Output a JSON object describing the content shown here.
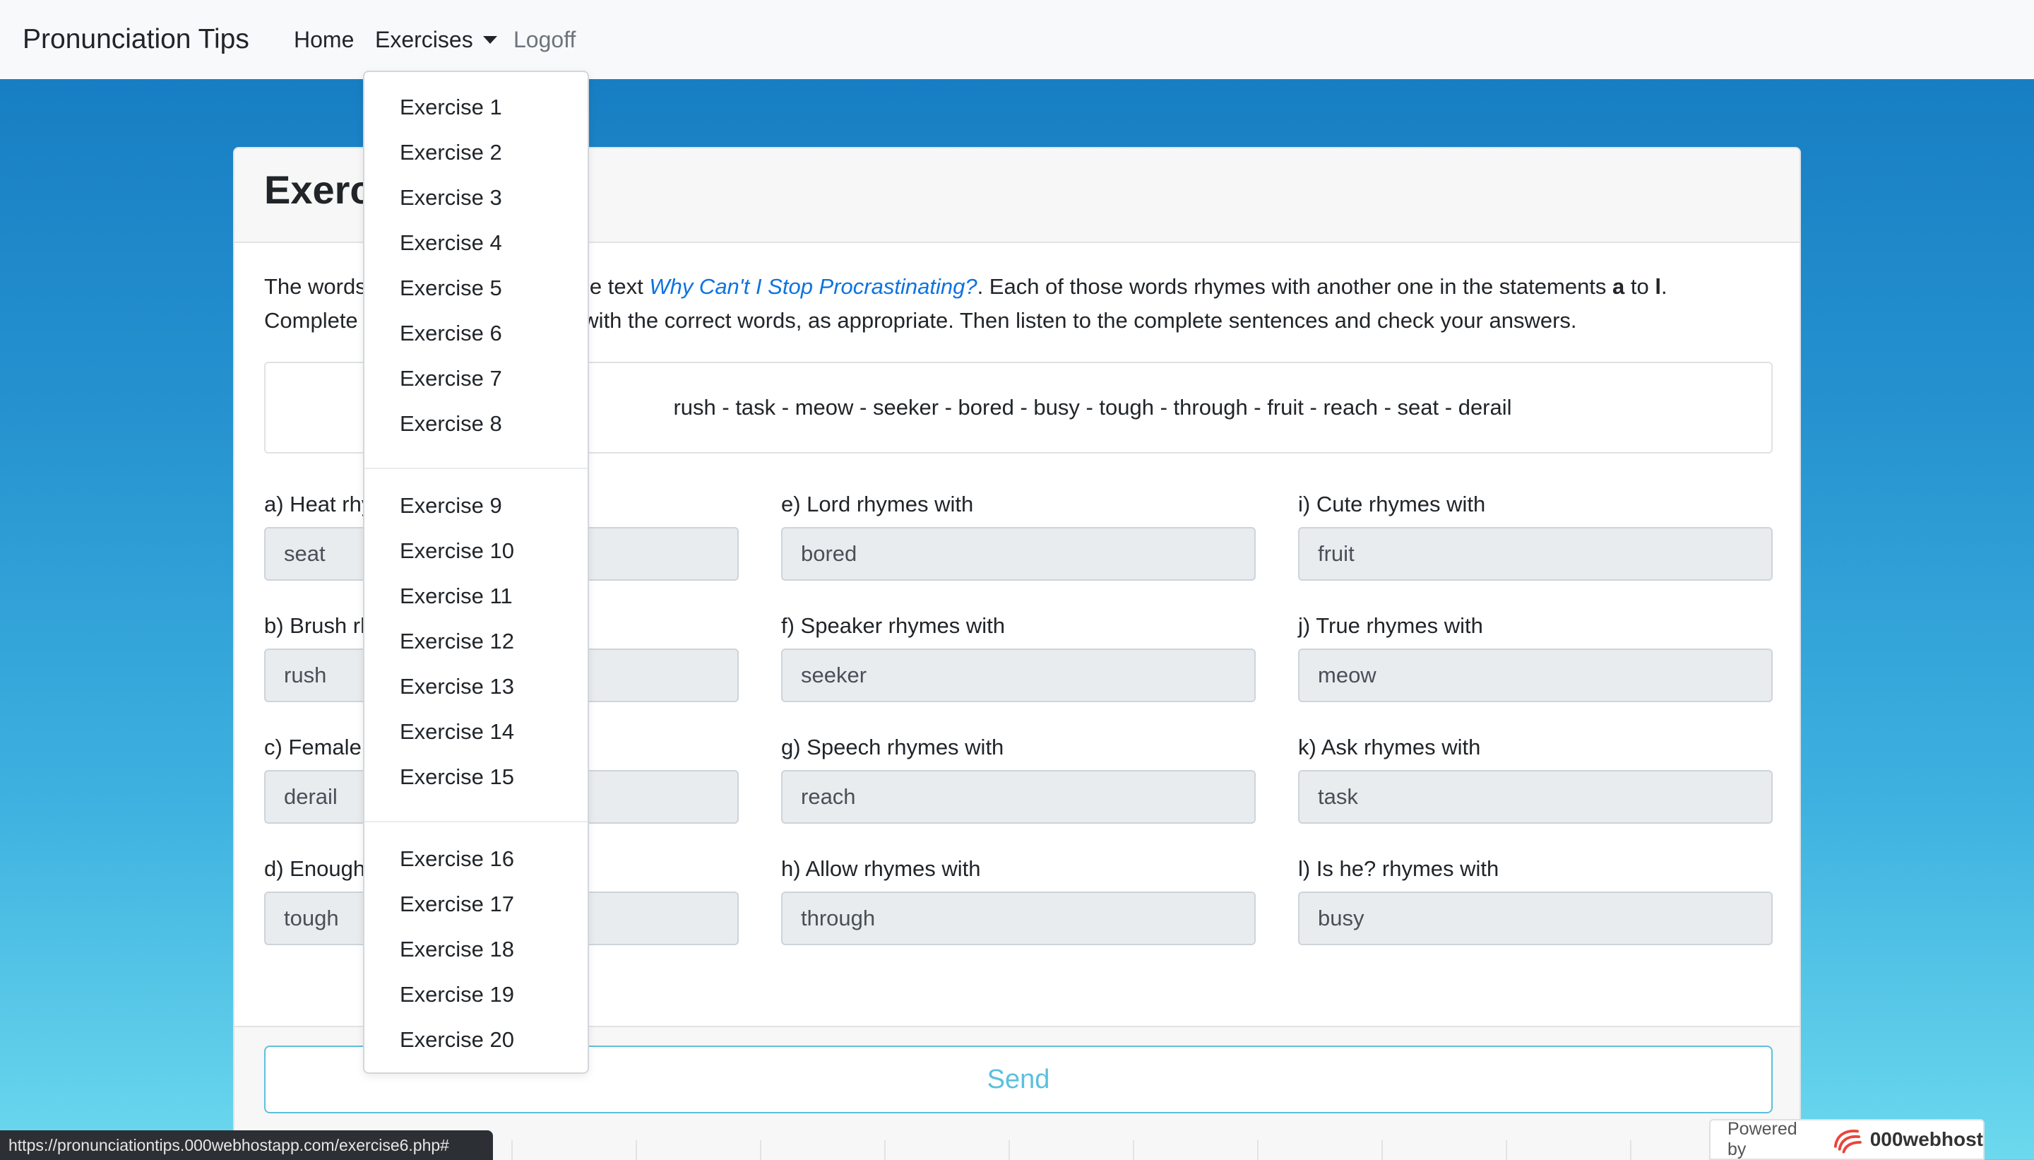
{
  "navbar": {
    "brand": "Pronunciation Tips",
    "home": "Home",
    "exercises": "Exercises",
    "logoff": "Logoff"
  },
  "card": {
    "title": "Exercise",
    "instructions": {
      "part1": "The words ",
      "part2": "om the text ",
      "link": "Why Can't I Stop Procrastinating?",
      "part3": ". Each of those words rhymes with another one in the statements ",
      "bold_a": "a",
      "part4": " to ",
      "bold_l": "l",
      "part5": ".",
      "line2a": "Complete ",
      "line2b": "with the correct words, as appropriate. Then listen to the complete sentences and check your answers."
    },
    "word_list": "rush - task - meow - seeker - bored - busy - tough - through - fruit - reach - seat - derail",
    "fields": [
      {
        "label": "a) Heat rhy",
        "value": "seat"
      },
      {
        "label": "b) Brush rh",
        "value": "rush"
      },
      {
        "label": "c) Female",
        "value": "derail"
      },
      {
        "label": "d) Enough",
        "value": "tough"
      },
      {
        "label": "e) Lord rhymes with",
        "value": "bored"
      },
      {
        "label": "f) Speaker rhymes with",
        "value": "seeker"
      },
      {
        "label": "g) Speech rhymes with",
        "value": "reach"
      },
      {
        "label": "h) Allow rhymes with",
        "value": "through"
      },
      {
        "label": "i) Cute rhymes with",
        "value": "fruit"
      },
      {
        "label": "j) True rhymes with",
        "value": "meow"
      },
      {
        "label": "k) Ask rhymes with",
        "value": "task"
      },
      {
        "label": "l) Is he? rhymes with",
        "value": "busy"
      }
    ],
    "send_label": "Send"
  },
  "dropdown": {
    "items": [
      "Exercise 1",
      "Exercise 2",
      "Exercise 3",
      "Exercise 4",
      "Exercise 5",
      "Exercise 6",
      "Exercise 7",
      "Exercise 8",
      "Exercise 9",
      "Exercise 10",
      "Exercise 11",
      "Exercise 12",
      "Exercise 13",
      "Exercise 14",
      "Exercise 15",
      "Exercise 16",
      "Exercise 17",
      "Exercise 18",
      "Exercise 19",
      "Exercise 20"
    ]
  },
  "statusbar": {
    "url": "https://pronunciationtips.000webhostapp.com/exercise6.php#"
  },
  "powered": {
    "label": "Powered by",
    "brand": "000webhost",
    "logo_icon": "000webhost-logo-icon"
  },
  "colors": {
    "accent_link": "#0d73e0",
    "send_info": "#5bc0de",
    "navbar_bg": "#f8f9fa",
    "input_bg": "#e9ecef"
  }
}
